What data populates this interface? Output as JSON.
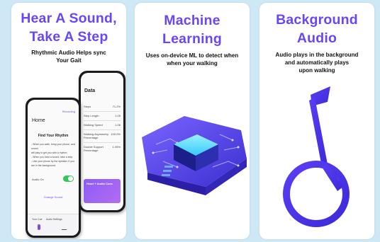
{
  "panels": [
    {
      "title_line1": "Hear A Sound,",
      "title_line2": "Take A Step",
      "subtitle_line1": "Rhythmic Audio Helps sync",
      "subtitle_line2": "Your Gait",
      "phone_front": {
        "header": "Home",
        "top_right": "Recording",
        "section_title": "Find Your Rhythm",
        "instructions": [
          "- When you walk, bring your phone, and sound",
          "  will play to get you with a rhythm.",
          "- When you hear a sound, take a step.",
          "- Use your phone by the speaker, if you",
          "  are in the background."
        ],
        "toggle_label": "Audio On",
        "change_sound": "Change Sound",
        "bottom_left": "Your Cue",
        "bottom_mid": "Audio Settings"
      },
      "phone_back": {
        "header": "Data",
        "rows": [
          {
            "label": "Steps",
            "value": "71.2%"
          },
          {
            "label": "Step Length",
            "value": "1.05"
          },
          {
            "label": "Walking Speed",
            "value": "1.06"
          },
          {
            "label": "Walking Asymmetry Percentage",
            "value": "100.0%"
          },
          {
            "label": "Double Support Percentage",
            "value": "1.05%"
          }
        ],
        "card_title": "Heart + Audio Cues"
      }
    },
    {
      "title_line1": "Machine",
      "title_line2": "Learning",
      "subtitle_line1": "Uses on-device ML to detect when",
      "subtitle_line2": "when your walking"
    },
    {
      "title_line1": "Background",
      "title_line2": "Audio",
      "subtitle_line1": "Audio plays in the background",
      "subtitle_line2": "and automatically plays",
      "subtitle_line3": "upon walking"
    }
  ],
  "colors": {
    "accent": "#6b46f4",
    "page_bg": "#cfe8f6",
    "chip_top": "#6fe0ff",
    "note": "#5b3ef5"
  },
  "icons": [
    "chip-illustration",
    "music-note-icon"
  ]
}
